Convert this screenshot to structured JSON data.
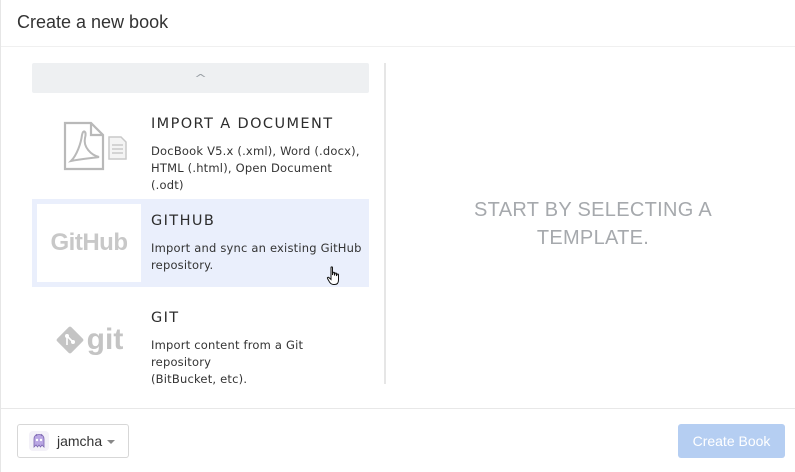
{
  "dialog": {
    "title": "Create a new book"
  },
  "templates": [
    {
      "title": "IMPORT A DOCUMENT",
      "description_line1": "DocBook V5.x (.xml), Word (.docx),",
      "description_line2": "HTML (.html), Open Document (.odt)",
      "icon": "pdf-and-document-icon",
      "selected": false
    },
    {
      "title": "GITHUB",
      "description_line1": "Import and sync an existing GitHub",
      "description_line2": "repository.",
      "logo_text": "GitHub",
      "icon": "github-logo",
      "selected": true
    },
    {
      "title": "GIT",
      "description_line1": "Import content from a Git repository",
      "description_line2": "(BitBucket, etc).",
      "logo_text": "git",
      "icon": "git-logo",
      "selected": false
    }
  ],
  "preview": {
    "placeholder": "START BY SELECTING A TEMPLATE."
  },
  "footer": {
    "owner_name": "jamcha",
    "create_label": "Create Book",
    "create_enabled": false
  },
  "colors": {
    "selected_bg": "#eaeffc",
    "create_button_disabled": "#b5cef2",
    "placeholder_text": "#a6a9ad"
  }
}
